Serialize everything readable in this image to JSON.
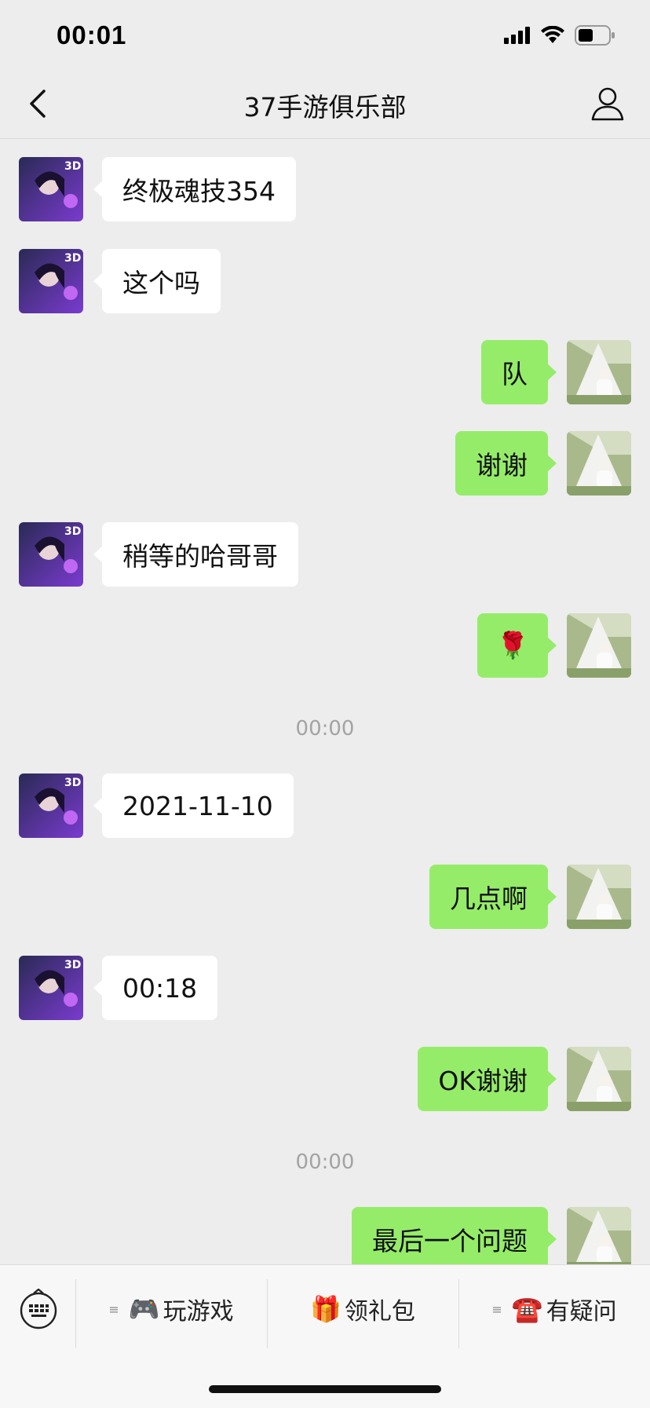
{
  "status_bar": {
    "time": "00:01"
  },
  "header": {
    "title": "37手游俱乐部"
  },
  "messages": [
    {
      "side": "in",
      "text": "终极魂技354"
    },
    {
      "side": "in",
      "text": "这个吗"
    },
    {
      "side": "out",
      "text": "队"
    },
    {
      "side": "out",
      "text": "谢谢"
    },
    {
      "side": "in",
      "text": "稍等的哈哥哥"
    },
    {
      "side": "out",
      "text": "🌹"
    },
    {
      "type": "time",
      "text": "00:00"
    },
    {
      "side": "in",
      "text": "2021-11-10"
    },
    {
      "side": "out",
      "text": "几点啊"
    },
    {
      "side": "in",
      "text": "00:18"
    },
    {
      "side": "out",
      "text": "OK谢谢"
    },
    {
      "type": "time",
      "text": "00:00"
    },
    {
      "side": "out",
      "text": "最后一个问题"
    }
  ],
  "menu": {
    "items": [
      {
        "icon": "🎮",
        "label": "玩游戏"
      },
      {
        "icon": "🎁",
        "label": "领礼包"
      },
      {
        "icon": "☎️",
        "label": "有疑问"
      }
    ]
  },
  "colors": {
    "background": "#ededed",
    "out_bubble": "#95ec69",
    "in_bubble": "#ffffff"
  }
}
